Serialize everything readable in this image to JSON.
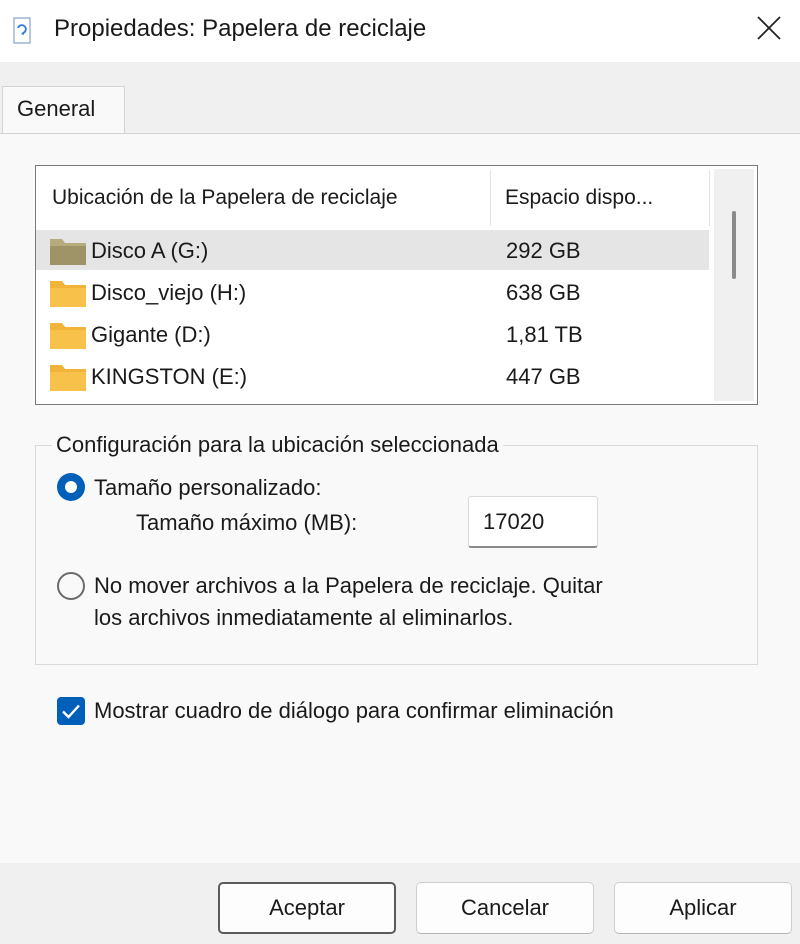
{
  "window": {
    "title": "Propiedades: Papelera de reciclaje"
  },
  "tabs": [
    {
      "label": "General"
    }
  ],
  "list": {
    "columns": [
      "Ubicación de la Papelera de reciclaje",
      "Espacio dispo..."
    ],
    "rows": [
      {
        "name": "Disco A (G:)",
        "size": "292 GB",
        "selected": true
      },
      {
        "name": "Disco_viejo (H:)",
        "size": "638 GB"
      },
      {
        "name": "Gigante (D:)",
        "size": "1,81 TB"
      },
      {
        "name": "KINGSTON (E:)",
        "size": "447 GB"
      }
    ]
  },
  "settings": {
    "group_title": "Configuración para la ubicación seleccionada",
    "custom_size_label": "Tamaño personalizado:",
    "max_size_label": "Tamaño máximo (MB):",
    "max_size_value": "17020",
    "no_move_line1": "No mover archivos a la Papelera de reciclaje. Quitar",
    "no_move_line2": "los archivos inmediatamente al eliminarlos.",
    "selected_option": "custom_size"
  },
  "confirm_dialog": {
    "label": "Mostrar cuadro de diálogo para confirmar eliminación",
    "checked": true
  },
  "buttons": {
    "ok": "Aceptar",
    "cancel": "Cancelar",
    "apply": "Aplicar"
  },
  "colors": {
    "accent": "#005fb8",
    "folder_yellow": "#f8c24a",
    "folder_selected": "#b5ab7d"
  }
}
